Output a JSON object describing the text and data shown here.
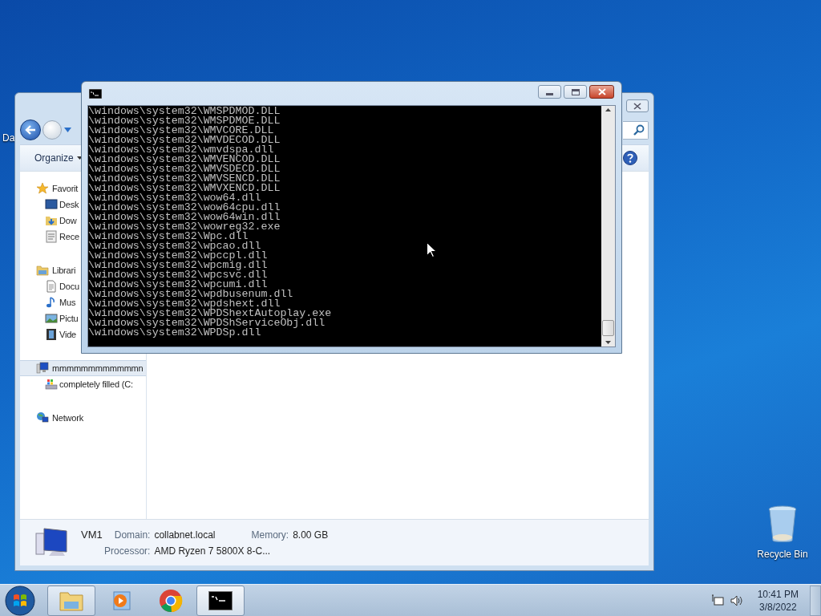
{
  "desktop": {
    "icons": [
      {
        "label": "Da",
        "kind": "partial"
      },
      {
        "label": "Recycle Bin",
        "kind": "recycle"
      }
    ]
  },
  "explorer": {
    "toolbar": {
      "organize": "Organize"
    },
    "nav": [
      {
        "label": "Favorit",
        "kind": "star",
        "selected": false,
        "children": [
          {
            "label": "Desk",
            "kind": "desktop",
            "selected": false
          },
          {
            "label": "Dow",
            "kind": "download",
            "selected": false
          },
          {
            "label": "Rece",
            "kind": "recent",
            "selected": false
          }
        ]
      },
      {
        "label": "Librari",
        "kind": "library",
        "selected": false,
        "children": [
          {
            "label": "Docu",
            "kind": "document",
            "selected": false
          },
          {
            "label": "Mus",
            "kind": "music",
            "selected": false
          },
          {
            "label": "Pictu",
            "kind": "picture",
            "selected": false
          },
          {
            "label": "Vide",
            "kind": "video",
            "selected": false
          }
        ]
      },
      {
        "label": "mmmmmmmmmmmmn",
        "kind": "computer",
        "selected": true,
        "children": [
          {
            "label": "completely filled (C:",
            "kind": "drive",
            "selected": false
          }
        ]
      },
      {
        "label": "Network",
        "kind": "network",
        "selected": false
      }
    ],
    "details": {
      "name": "VM1",
      "fields": [
        {
          "label": "Domain:",
          "value": "collabnet.local"
        },
        {
          "label": "Memory:",
          "value": "8.00 GB"
        },
        {
          "label": "Processor:",
          "value": "AMD Ryzen 7 5800X 8-C..."
        }
      ]
    }
  },
  "console": {
    "lines": [
      "\\windows\\system32\\WMSPDMOD.DLL",
      "\\windows\\system32\\WMSPDMOE.DLL",
      "\\windows\\system32\\WMVCORE.DLL",
      "\\windows\\system32\\WMVDECOD.DLL",
      "\\windows\\system32\\wmvdspa.dll",
      "\\windows\\system32\\WMVENCOD.DLL",
      "\\windows\\system32\\WMVSDECD.DLL",
      "\\windows\\system32\\WMVSENCD.DLL",
      "\\windows\\system32\\WMVXENCD.DLL",
      "\\windows\\system32\\wow64.dll",
      "\\windows\\system32\\wow64cpu.dll",
      "\\windows\\system32\\wow64win.dll",
      "\\windows\\system32\\wowreg32.exe",
      "\\windows\\system32\\Wpc.dll",
      "\\windows\\system32\\wpcao.dll",
      "\\windows\\system32\\wpccpl.dll",
      "\\windows\\system32\\wpcmig.dll",
      "\\windows\\system32\\wpcsvc.dll",
      "\\windows\\system32\\wpcumi.dll",
      "\\windows\\system32\\wpdbusenum.dll",
      "\\windows\\system32\\wpdshext.dll",
      "\\windows\\system32\\WPDShextAutoplay.exe",
      "\\windows\\system32\\WPDShServiceObj.dll",
      "\\windows\\system32\\WPDSp.dll"
    ]
  },
  "taskbar": {
    "items": [
      {
        "kind": "explorer",
        "running": true,
        "selected": false
      },
      {
        "kind": "media",
        "running": false,
        "selected": false
      },
      {
        "kind": "chrome",
        "running": false,
        "selected": false
      },
      {
        "kind": "console",
        "running": true,
        "selected": true
      }
    ],
    "clock": {
      "time": "10:41 PM",
      "date": "3/8/2022"
    }
  }
}
